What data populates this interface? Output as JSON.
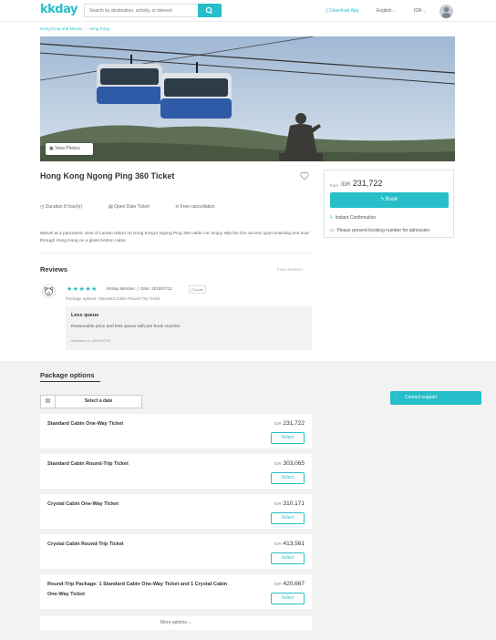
{
  "header": {
    "logo": "kkday",
    "search_placeholder": "Search by destination, activity, or interest",
    "download_app": "Download App",
    "language": "English",
    "currency": "IDR"
  },
  "breadcrumb": [
    "Hong Kong and Macau",
    "Hong Kong"
  ],
  "hero": {
    "view_photos": "View Photos"
  },
  "product": {
    "title": "Hong Kong Ngong Ping 360 Ticket",
    "duration": "Duration 8 hour(s)",
    "open_date": "Open Date Ticket",
    "free_cancel": "Free cancellation",
    "description": "Marvel at a panoramic view of Lantau Island on Hong Kong's Ngong Ping 360 cable car. Enjoy skip the line access upon boarding and soar through Hong Kong on a glass bottom cabin."
  },
  "booking": {
    "from": "from",
    "currency": "IDR",
    "price": "231,722",
    "book_label": "Book",
    "instant": "Instant Confirmation",
    "present": "Please present booking number for admission"
  },
  "reviews": {
    "heading": "Reviews",
    "more": "more reviews",
    "reviewer": "KKday Member",
    "date": "Date: 2019/07/12",
    "tag": "Couple",
    "package": "Package options: Standard Cabin Round-Trip Ticket",
    "review_title": "Less queue",
    "review_body": "Reasonable price and less queue with pre book voucher",
    "reviewed_on": "reviewed on 2019/07/15",
    "rating": 5
  },
  "packages": {
    "heading": "Package options",
    "select_date": "Select a date",
    "currency": "IDR",
    "select_label": "Select",
    "items": [
      {
        "name": "Standard Cabin One-Way Ticket",
        "price": "231,722"
      },
      {
        "name": "Standard Cabin Round-Trip Ticket",
        "price": "303,065"
      },
      {
        "name": "Crystal Cabin One-Way Ticket",
        "price": "310,171"
      },
      {
        "name": "Crystal Cabin Round-Trip Ticket",
        "price": "413,561"
      },
      {
        "name": "Round-Trip Package: 1 Standard Cabin One-Way Ticket and 1 Crystal Cabin One-Way Ticket",
        "price": "420,667"
      }
    ],
    "more_options": "More options"
  },
  "contact_support": "Contact support"
}
